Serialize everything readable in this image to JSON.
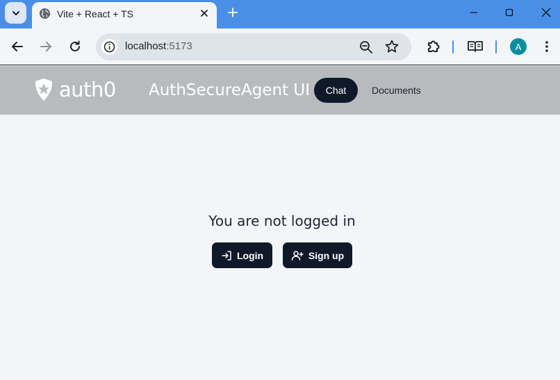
{
  "browser": {
    "tab_title": "Vite + React + TS",
    "url_host": "localhost",
    "url_port": ":5173",
    "avatar_letter": "A"
  },
  "header": {
    "logo_text": "auth0",
    "app_title": "AuthSecureAgent UI",
    "nav": {
      "chat": "Chat",
      "documents": "Documents"
    }
  },
  "main": {
    "message": "You are not logged in",
    "login_label": "Login",
    "signup_label": "Sign up"
  },
  "colors": {
    "tabstrip": "#4a8fe7",
    "header_bg": "#b8bbbe",
    "button_dark": "#0f1929",
    "page_bg": "#f3f5f9"
  }
}
